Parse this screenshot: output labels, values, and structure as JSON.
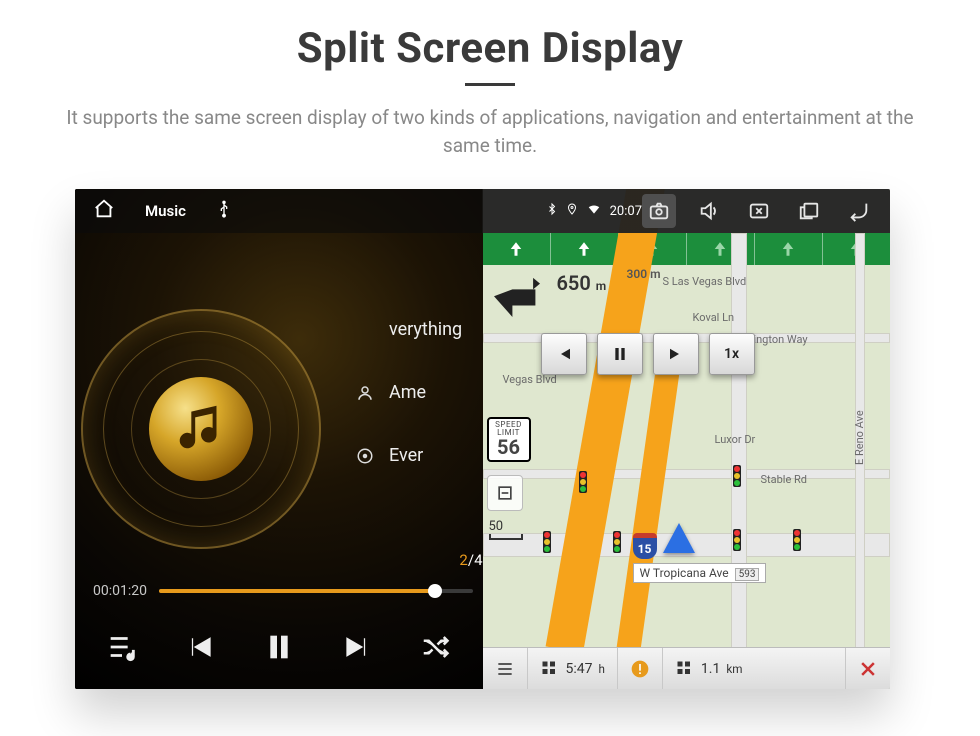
{
  "header": {
    "title": "Split Screen Display",
    "description": "It supports the same screen display of two kinds of applications, navigation and entertainment at the same time."
  },
  "topbar": {
    "app_label": "Music",
    "source_label": "Ψ",
    "clock": "20:07"
  },
  "music": {
    "tracks": {
      "row1": "verything",
      "row2": "Ame",
      "row3": "Ever"
    },
    "page_indicator": {
      "current": "2",
      "separator": "/",
      "total": "4"
    },
    "elapsed": "00:01:20"
  },
  "nav": {
    "turn": {
      "next_distance": "650",
      "next_unit": "m",
      "after_distance": "300",
      "after_unit": "m"
    },
    "roads": {
      "s_las_vegas": "S Las Vegas Blvd",
      "koval": "Koval Ln",
      "duke": "Duke Ellington Way",
      "vegas_blvd": "Vegas Blvd",
      "luxor": "Luxor Dr",
      "stable": "Stable Rd",
      "reno": "E Reno Ave",
      "tropicana": "W Tropicana Ave",
      "tropicana_exit": "593"
    },
    "speed_sign": {
      "label_top": "SPEED",
      "label_mid": "LIMIT",
      "value": "56"
    },
    "scale": "50",
    "playback_speed": "1x",
    "shield": "15",
    "bottom": {
      "eta": "5:47",
      "eta_unit": "h",
      "dist": "1.1",
      "dist_unit": "km"
    }
  }
}
